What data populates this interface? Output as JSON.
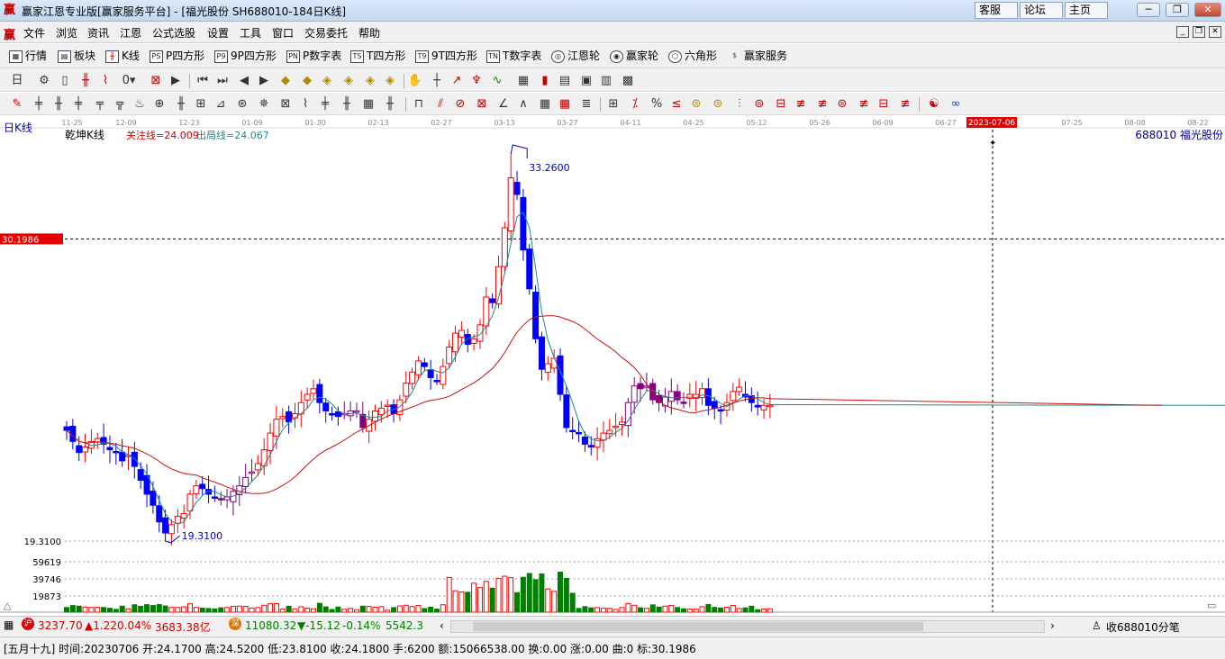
{
  "window": {
    "title": "赢家江恩专业版[赢家服务平台] - [福光股份   SH688010-184日K线]",
    "buttons": [
      "客服",
      "论坛",
      "主页"
    ]
  },
  "menu": [
    "文件",
    "浏览",
    "资讯",
    "江恩",
    "公式选股",
    "设置",
    "工具",
    "窗口",
    "交易委托",
    "帮助"
  ],
  "toolbar1": [
    {
      "icon": "table-icon",
      "label": "行情"
    },
    {
      "icon": "blocks-icon",
      "label": "板块"
    },
    {
      "icon": "candle-icon",
      "label": "K线"
    },
    {
      "icon": "ps-icon",
      "label": "P四方形"
    },
    {
      "icon": "p9-icon",
      "label": "9P四方形"
    },
    {
      "icon": "pn-icon",
      "label": "P数字表"
    },
    {
      "icon": "ts-icon",
      "label": "T四方形"
    },
    {
      "icon": "t9-icon",
      "label": "9T四方形"
    },
    {
      "icon": "tn-icon",
      "label": "T数字表"
    },
    {
      "icon": "gann-wheel-icon",
      "label": "江恩轮"
    },
    {
      "icon": "winner-wheel-icon",
      "label": "赢家轮"
    },
    {
      "icon": "hexagon-icon",
      "label": "六角形"
    },
    {
      "icon": "dollar-icon",
      "label": "赢家服务"
    }
  ],
  "chart_header": {
    "period": "日K线",
    "indicator": "乾坤K线",
    "watch_line": "关注线=24.009",
    "exit_line": "出局线=24.067",
    "stock": "688010  福光股份",
    "cursor_price": "30.1986",
    "cursor_date": "2023-07-06",
    "low_axis_label": "19.3100",
    "vol_ticks": [
      "59619",
      "39746",
      "19873"
    ]
  },
  "chart_data": {
    "type": "candlestick",
    "x_ticks": [
      "11-25",
      "12-09",
      "12-23",
      "01-09",
      "01-30",
      "02-13",
      "02-27",
      "03-13",
      "03-27",
      "04-11",
      "04-25",
      "05-12",
      "05-26",
      "06-09",
      "06-27",
      "2023-07-06",
      "07-25",
      "08-08",
      "08-22"
    ],
    "annotations": {
      "high": "33.2600",
      "low": "19.3100"
    },
    "closes": [
      23.3,
      22.9,
      22.5,
      22.7,
      22.9,
      23.0,
      22.8,
      22.6,
      22.5,
      22.2,
      22.4,
      22.0,
      21.5,
      21.0,
      20.6,
      20.0,
      19.6,
      19.9,
      20.2,
      20.3,
      21.0,
      21.3,
      21.2,
      21.0,
      20.9,
      20.8,
      20.9,
      21.1,
      21.3,
      21.6,
      21.8,
      22.1,
      22.6,
      23.2,
      23.7,
      23.8,
      23.6,
      23.9,
      24.3,
      24.6,
      24.8,
      24.3,
      24.0,
      23.9,
      23.8,
      23.9,
      24.0,
      24.0,
      23.4,
      23.7,
      24.0,
      24.1,
      24.2,
      23.9,
      24.4,
      25.0,
      25.4,
      25.8,
      25.6,
      25.2,
      25.1,
      25.6,
      26.3,
      26.8,
      26.9,
      26.4,
      26.6,
      27.1,
      28.1,
      27.9,
      29.2,
      30.6,
      32.4,
      31.8,
      29.8,
      28.4,
      26.6,
      25.5,
      25.7,
      25.9,
      24.6,
      23.4,
      23.3,
      23.2,
      22.8,
      22.7,
      23.0,
      23.2,
      23.3,
      23.4,
      23.6,
      24.3,
      24.9,
      24.8,
      24.9,
      24.4,
      24.3,
      24.5,
      24.7,
      24.4,
      24.3,
      24.6,
      24.6,
      24.8,
      24.2,
      24.1,
      24.0,
      24.3,
      24.7,
      24.7,
      24.5,
      24.3,
      24.2,
      24.2,
      24.2
    ],
    "volume_max": 80000,
    "series": [
      {
        "name": "MA-short",
        "color": "#1c8a8a"
      },
      {
        "name": "MA-long",
        "color": "#c81010"
      }
    ]
  },
  "status1": {
    "sh_index": "3237.70",
    "sh_change": "▲1.22",
    "sh_pct": "0.04%",
    "sh_amount": "3683.38亿",
    "sz_index": "11080.32",
    "sz_change": "▼-15.12",
    "sz_pct": "-0.14%",
    "sz_amount": "5542.3",
    "right_label": "收688010分笔"
  },
  "status2": {
    "text": "[五月十九] 时间:20230706 开:24.1700 高:24.5200 低:23.8100 收:24.1800 手:6200 额:15066538.00 换:0.00 涨:0.00 曲:0 标:30.1986"
  }
}
